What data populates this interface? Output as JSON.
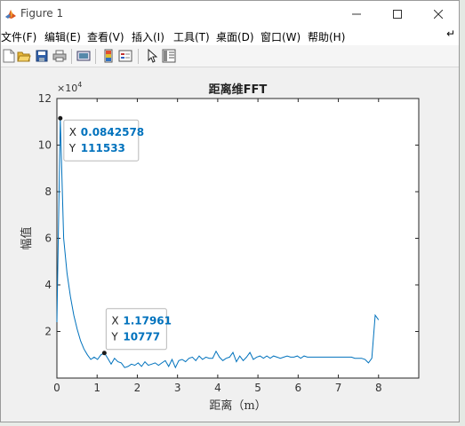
{
  "window": {
    "title": "Figure 1",
    "min_icon": "minimize-icon",
    "max_icon": "maximize-icon",
    "close_icon": "close-icon",
    "app_icon": "matlab-icon"
  },
  "menu": {
    "items": [
      "文件(F)",
      "编辑(E)",
      "查看(V)",
      "插入(I)",
      "工具(T)",
      "桌面(D)",
      "窗口(W)",
      "帮助(H)"
    ],
    "overflow_icon": "menu-overflow-icon"
  },
  "toolbar": {
    "tools": [
      "new-figure-icon",
      "open-file-icon",
      "save-icon",
      "print-icon",
      "link-plot-icon",
      "insert-colorbar-icon",
      "insert-legend-icon",
      "edit-plot-icon",
      "property-inspector-icon"
    ]
  },
  "colors": {
    "line": "#0072bd",
    "datatip_value": "#0072bd",
    "axes_bg": "#ffffff",
    "figure_bg": "#f0f0f0"
  },
  "chart_data": {
    "type": "line",
    "title": "距离维FFT",
    "xlabel": "距离（m）",
    "ylabel": "幅值",
    "y_exponent": "×10",
    "y_exponent_power": "4",
    "xlim": [
      0,
      9
    ],
    "ylim": [
      0,
      120000
    ],
    "xticks": [
      "0",
      "1",
      "2",
      "3",
      "4",
      "5",
      "6",
      "7",
      "8"
    ],
    "yticks": [
      "2",
      "4",
      "6",
      "8",
      "10",
      "12"
    ],
    "grid": false,
    "x": [
      0.0,
      0.084,
      0.168,
      0.252,
      0.337,
      0.421,
      0.505,
      0.589,
      0.673,
      0.758,
      0.842,
      0.926,
      1.011,
      1.095,
      1.18,
      1.264,
      1.348,
      1.432,
      1.516,
      1.6,
      1.685,
      1.769,
      1.853,
      1.937,
      2.021,
      2.106,
      2.19,
      2.274,
      2.358,
      2.443,
      2.527,
      2.611,
      2.695,
      2.779,
      2.864,
      2.948,
      3.032,
      3.116,
      3.2,
      3.285,
      3.369,
      3.453,
      3.537,
      3.622,
      3.706,
      3.79,
      3.874,
      3.958,
      4.043,
      4.127,
      4.211,
      4.295,
      4.379,
      4.464,
      4.548,
      4.632,
      4.716,
      4.8,
      4.885,
      4.969,
      5.053,
      5.137,
      5.221,
      5.306,
      5.39,
      5.474,
      5.558,
      5.643,
      5.727,
      5.811,
      5.895,
      5.979,
      6.064,
      6.148,
      6.232,
      6.316,
      6.4,
      6.485,
      6.569,
      6.653,
      6.737,
      6.821,
      6.906,
      6.99,
      7.074,
      7.158,
      7.243,
      7.327,
      7.411,
      7.495,
      7.579,
      7.664,
      7.748,
      7.832,
      7.916,
      8.0
    ],
    "values": [
      24000,
      111533,
      60000,
      45000,
      35000,
      27000,
      21000,
      16000,
      12500,
      10000,
      8000,
      9000,
      8000,
      10000,
      10777,
      8500,
      6000,
      8500,
      7000,
      6500,
      4500,
      5000,
      6000,
      5500,
      6500,
      5000,
      7000,
      5500,
      6000,
      6500,
      5500,
      6500,
      7500,
      5000,
      8000,
      4500,
      7500,
      8000,
      7000,
      8500,
      9000,
      7500,
      9500,
      8000,
      9000,
      8500,
      8500,
      11500,
      9000,
      7500,
      8500,
      9000,
      11000,
      7000,
      9500,
      7500,
      9000,
      11000,
      8000,
      9000,
      9500,
      8500,
      9500,
      8500,
      9500,
      9000,
      8500,
      9000,
      9500,
      9000,
      9000,
      9500,
      8500,
      9500,
      9000,
      9000,
      9000,
      9000,
      9000,
      9000,
      9000,
      9000,
      9000,
      9000,
      9000,
      9000,
      9000,
      9000,
      8500,
      8500,
      8500,
      8000,
      6500,
      8500,
      27000,
      25000
    ],
    "datatips": [
      {
        "x": "0.0842578",
        "y": "111533",
        "xv": 0.0842578,
        "yv": 111533
      },
      {
        "x": "1.17961",
        "y": "10777",
        "xv": 1.17961,
        "yv": 10777
      }
    ],
    "datatip_labels": {
      "x": "X",
      "y": "Y"
    }
  }
}
